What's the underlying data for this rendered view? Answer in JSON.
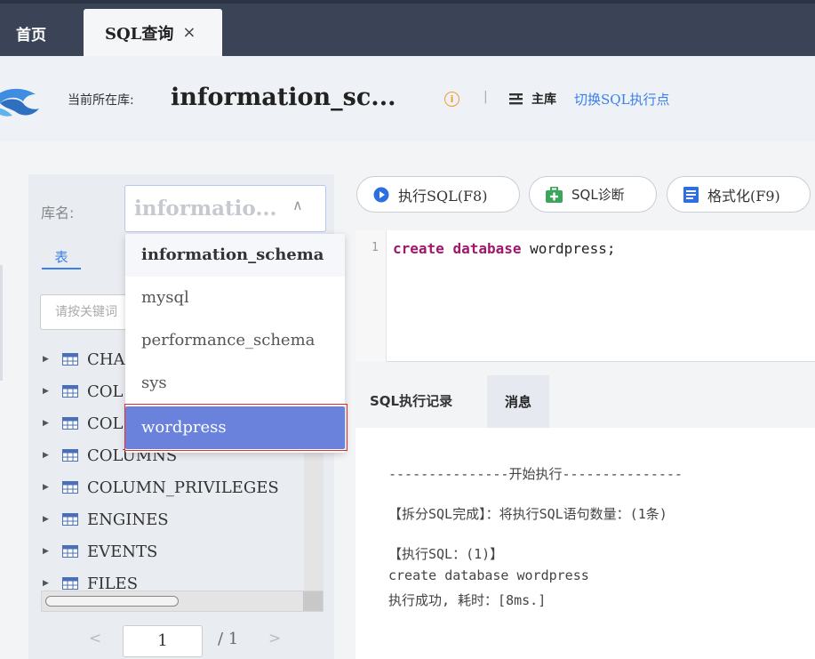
{
  "tabs": {
    "home": "首页",
    "sql": "SQL查询",
    "close": "×"
  },
  "header": {
    "current_db_label": "当前所在库:",
    "current_db": "information_sc...",
    "info_icon": "info-icon",
    "separator": "|",
    "main_label": "主库",
    "switch_link": "切换SQL执行点"
  },
  "left": {
    "db_label": "库名:",
    "db_value": "informatio...",
    "tab_table": "表",
    "search_placeholder": "请按关键词",
    "tables": [
      "CHA",
      "COL",
      "COL",
      "COLUMNS",
      "COLUMN_PRIVILEGES",
      "ENGINES",
      "EVENTS",
      "FILES"
    ],
    "page_current": "1",
    "page_total": "/ 1",
    "prev": "<",
    "next": ">"
  },
  "dropdown": {
    "options": [
      "information_schema",
      "mysql",
      "performance_schema",
      "sys",
      "wordpress"
    ],
    "selected": "wordpress"
  },
  "toolbar": {
    "run": "执行SQL(F8)",
    "diagnose": "SQL诊断",
    "format": "格式化(F9)"
  },
  "editor": {
    "line_no": "1",
    "kw1": "create",
    "kw2": "database",
    "rest": " wordpress;"
  },
  "result": {
    "tab_history": "SQL执行记录",
    "tab_message": "消息",
    "lines": [
      "---------------开始执行---------------",
      "【拆分SQL完成】：将执行SQL语句数量：(1条)",
      "【执行SQL：(1)】",
      "create database wordpress",
      "执行成功, 耗时：[8ms.]"
    ]
  },
  "colors": {
    "accent": "#3a7ff0",
    "selected": "#6a82dc",
    "topbar": "#3b4356"
  }
}
